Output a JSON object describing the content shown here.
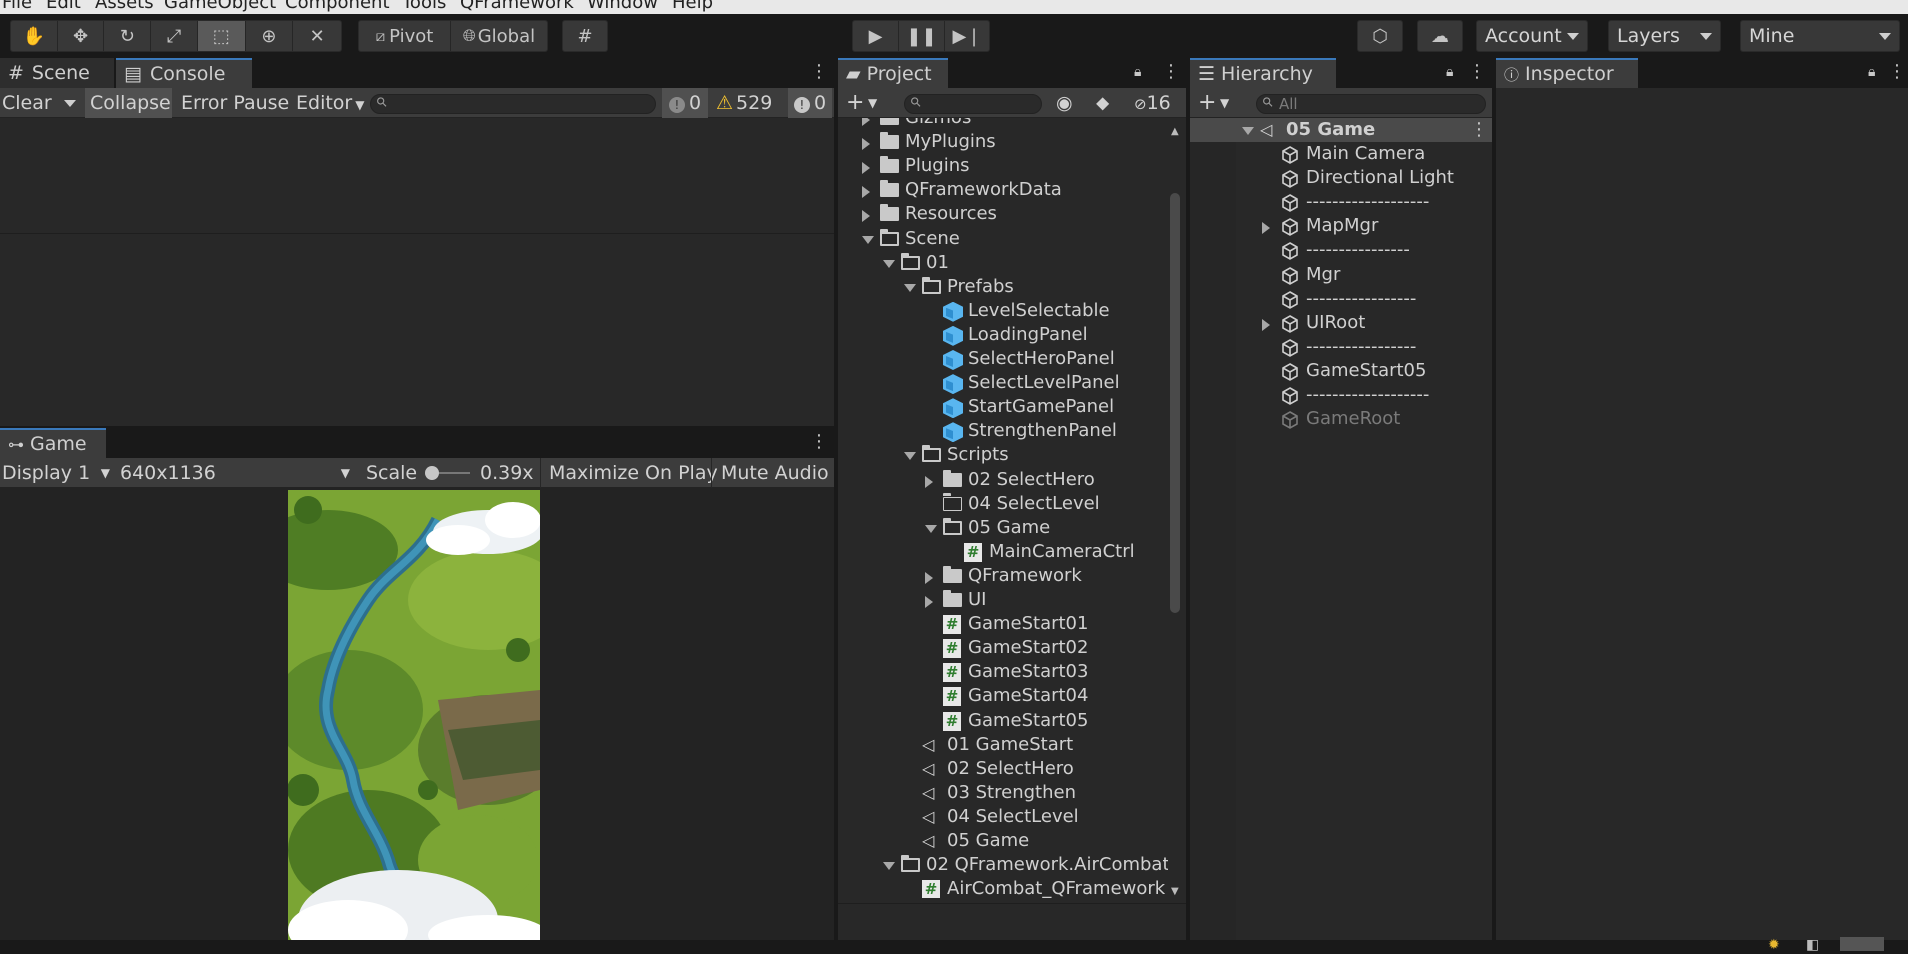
{
  "menu": [
    "File",
    "Edit",
    "Assets",
    "GameObject",
    "Component",
    "Tools",
    "QFramework",
    "Window",
    "Help"
  ],
  "toolbar": {
    "pivot_label": "Pivot",
    "global_label": "Global",
    "account_label": "Account",
    "layers_label": "Layers",
    "layout_label": "Mine"
  },
  "console": {
    "tab_scene": "Scene",
    "tab_console": "Console",
    "clear_label": "Clear",
    "collapse_label": "Collapse",
    "error_pause_label": "Error Pause",
    "editor_label": "Editor",
    "search_placeholder": "",
    "log_count": "0",
    "warning_count": "529",
    "error_count": "0"
  },
  "game": {
    "tab_label": "Game",
    "display_label": "Display 1",
    "resolution_label": "640x1136",
    "scale_label": "Scale",
    "scale_value": "0.39x",
    "maximize_label": "Maximize On Play",
    "mute_label": "Mute Audio",
    "scale_slider_value": 0.02
  },
  "project": {
    "tab_label": "Project",
    "hidden_count": "16",
    "items": [
      {
        "label": "Gizmos",
        "icon": "folder-icon"
      },
      {
        "label": "MyPlugins",
        "icon": "folder-icon"
      },
      {
        "label": "Plugins",
        "icon": "folder-icon"
      },
      {
        "label": "QFrameworkData",
        "icon": "folder-icon"
      },
      {
        "label": "Resources",
        "icon": "folder-icon"
      },
      {
        "label": "Scene",
        "icon": "folder-open-icon"
      },
      {
        "label": "01",
        "icon": "folder-open-icon"
      },
      {
        "label": "Prefabs",
        "icon": "folder-open-icon"
      },
      {
        "label": "LevelSelectable",
        "icon": "prefab-icon"
      },
      {
        "label": "LoadingPanel",
        "icon": "prefab-icon"
      },
      {
        "label": "SelectHeroPanel",
        "icon": "prefab-icon"
      },
      {
        "label": "SelectLevelPanel",
        "icon": "prefab-icon"
      },
      {
        "label": "StartGamePanel",
        "icon": "prefab-icon"
      },
      {
        "label": "StrengthenPanel",
        "icon": "prefab-icon"
      },
      {
        "label": "Scripts",
        "icon": "folder-open-icon"
      },
      {
        "label": "02 SelectHero",
        "icon": "folder-icon"
      },
      {
        "label": "04 SelectLevel",
        "icon": "folder-empty-icon"
      },
      {
        "label": "05 Game",
        "icon": "folder-open-icon"
      },
      {
        "label": "MainCameraCtrl",
        "icon": "script-icon"
      },
      {
        "label": "QFramework",
        "icon": "folder-icon"
      },
      {
        "label": "UI",
        "icon": "folder-icon"
      },
      {
        "label": "GameStart01",
        "icon": "script-icon"
      },
      {
        "label": "GameStart02",
        "icon": "script-icon"
      },
      {
        "label": "GameStart03",
        "icon": "script-icon"
      },
      {
        "label": "GameStart04",
        "icon": "script-icon"
      },
      {
        "label": "GameStart05",
        "icon": "script-icon"
      },
      {
        "label": "01 GameStart",
        "icon": "scene-icon"
      },
      {
        "label": "02 SelectHero",
        "icon": "scene-icon"
      },
      {
        "label": "03 Strengthen",
        "icon": "scene-icon"
      },
      {
        "label": "04 SelectLevel",
        "icon": "scene-icon"
      },
      {
        "label": "05 Game",
        "icon": "scene-icon"
      },
      {
        "label": "02 QFramework.AirCombat",
        "icon": "folder-open-icon"
      },
      {
        "label": "AirCombat_QFramework",
        "icon": "script-icon"
      }
    ]
  },
  "hierarchy": {
    "tab_label": "Hierarchy",
    "search_placeholder": "All",
    "scene_label": "05 Game",
    "items": [
      {
        "label": "Main Camera"
      },
      {
        "label": "Directional Light"
      },
      {
        "label": "-------------------"
      },
      {
        "label": "MapMgr"
      },
      {
        "label": "----------------"
      },
      {
        "label": "Mgr"
      },
      {
        "label": "-----------------"
      },
      {
        "label": "UIRoot"
      },
      {
        "label": "-----------------"
      },
      {
        "label": "GameStart05"
      },
      {
        "label": "-------------------"
      },
      {
        "label": "GameRoot"
      }
    ]
  },
  "inspector": {
    "tab_label": "Inspector"
  },
  "colors": {
    "accent": "#3a79bb",
    "prefab": "#59b6f0",
    "warning": "#f0c030"
  }
}
